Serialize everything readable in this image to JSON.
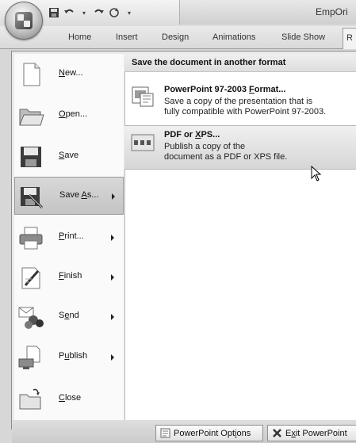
{
  "titlebar": {
    "app_title": "EmpOri",
    "qat_icons": [
      "save-icon",
      "undo-icon",
      "redo-icon",
      "customize-icon"
    ]
  },
  "ribbon": {
    "tabs": [
      "Home",
      "Insert",
      "Design",
      "Animations",
      "Slide Show"
    ],
    "last_tab_initial": "R"
  },
  "left_menu": {
    "items": [
      {
        "label": "New...",
        "icon": "new-document-icon",
        "has_arrow": false
      },
      {
        "label": "Open...",
        "icon": "open-folder-icon",
        "has_arrow": false
      },
      {
        "label": "Save",
        "icon": "save-disk-icon",
        "has_arrow": false
      },
      {
        "label": "Save As...",
        "icon": "save-as-icon",
        "has_arrow": true,
        "active": true
      },
      {
        "label": "Print...",
        "icon": "print-icon",
        "has_arrow": true
      },
      {
        "label": "Finish",
        "icon": "finish-icon",
        "has_arrow": true
      },
      {
        "label": "Send",
        "icon": "send-icon",
        "has_arrow": true
      },
      {
        "label": "Publish",
        "icon": "publish-icon",
        "has_arrow": true
      },
      {
        "label": "Close",
        "icon": "close-folder-icon",
        "has_arrow": false
      }
    ]
  },
  "right_panel": {
    "header": "Save the document in another format",
    "items": [
      {
        "title": "PowerPoint 97-2003 Format...",
        "desc_line1": "Save a copy of the presentation that is",
        "desc_line2": "fully compatible with PowerPoint 97-2003."
      },
      {
        "title": "PDF or XPS...",
        "desc_line1": "Publish a copy of the",
        "desc_line2": "document as a PDF or XPS file.",
        "hovered": true
      }
    ]
  },
  "bottom": {
    "options_label": "PowerPoint Options",
    "exit_label": "Exit PowerPoint"
  }
}
